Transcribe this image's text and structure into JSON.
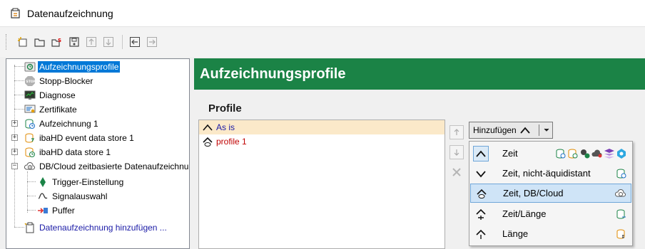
{
  "window": {
    "title": "Datenaufzeichnung"
  },
  "toolbar": {
    "buttons": [
      {
        "name": "new-icon"
      },
      {
        "name": "open-folder-icon"
      },
      {
        "name": "export-icon"
      },
      {
        "name": "save-icon"
      },
      {
        "name": "move-up-icon"
      },
      {
        "name": "move-down-icon"
      },
      {
        "name": "collapse-left-icon"
      },
      {
        "name": "expand-right-icon"
      }
    ]
  },
  "tree": {
    "items": [
      {
        "label": "Aufzeichnungsprofile",
        "icon": "profiles-icon",
        "selected": true
      },
      {
        "label": "Stopp-Blocker",
        "icon": "stop-icon"
      },
      {
        "label": "Diagnose",
        "icon": "monitor-icon"
      },
      {
        "label": "Zertifikate",
        "icon": "certificate-icon"
      },
      {
        "label": "Aufzeichnung 1",
        "icon": "recording-icon"
      },
      {
        "label": "ibaHD event data store 1",
        "icon": "event-store-icon"
      },
      {
        "label": "ibaHD data store 1",
        "icon": "data-store-icon"
      },
      {
        "label": "DB/Cloud zeitbasierte Datenaufzeichnung",
        "icon": "cloud-store-icon"
      },
      {
        "label": "Trigger-Einstellung",
        "icon": "trigger-icon"
      },
      {
        "label": "Signalauswahl",
        "icon": "signal-icon"
      },
      {
        "label": "Puffer",
        "icon": "buffer-icon"
      },
      {
        "label": "Datenaufzeichnung hinzufügen ...",
        "icon": "add-recording-icon"
      }
    ]
  },
  "main": {
    "page_title": "Aufzeichnungsprofile",
    "section_title": "Profile",
    "profiles": [
      {
        "label": "As is",
        "color": "#1a1aa6",
        "selected": true
      },
      {
        "label": "profile 1",
        "color": "#c00000"
      }
    ],
    "add_button": {
      "label": "Hinzufügen"
    },
    "menu": {
      "items": [
        {
          "label": "Zeit",
          "checked": true
        },
        {
          "label": "Zeit, nicht-äquidistant"
        },
        {
          "label": "Zeit, DB/Cloud",
          "highlighted": true
        },
        {
          "label": "Zeit/Länge"
        },
        {
          "label": "Länge"
        }
      ]
    }
  },
  "colors": {
    "banner": "#1b8346",
    "selection": "#0078d7",
    "profile_selection": "#fbe9c9",
    "menu_highlight": "#cfe4f7"
  }
}
